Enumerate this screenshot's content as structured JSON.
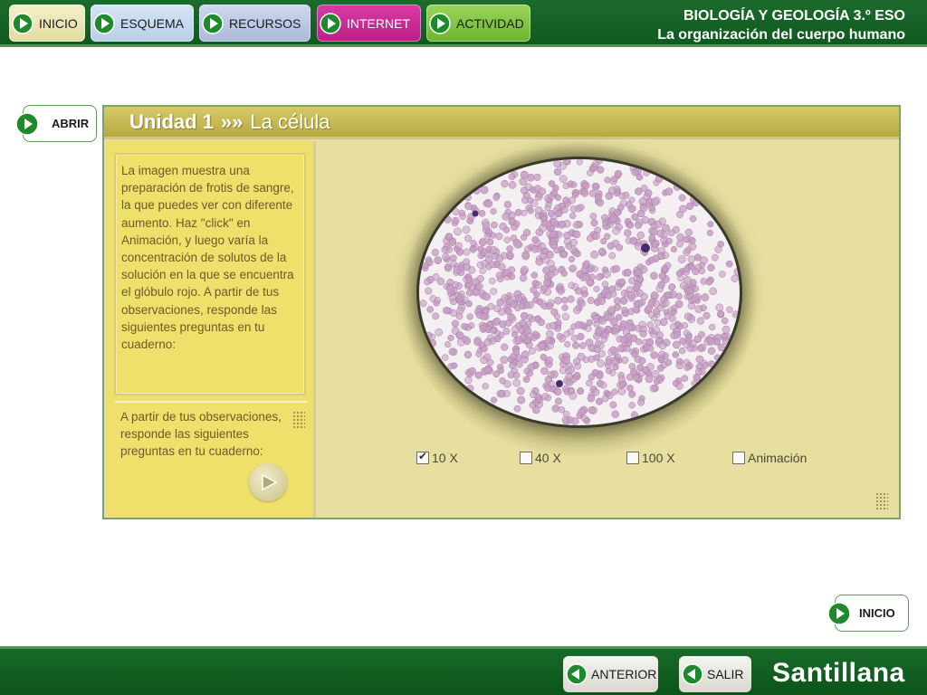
{
  "header": {
    "nav": [
      {
        "label": "INICIO"
      },
      {
        "label": "ESQUEMA"
      },
      {
        "label": "RECURSOS"
      },
      {
        "label": "INTERNET"
      },
      {
        "label": "ACTIVIDAD"
      }
    ],
    "course_line1": "BIOLOGÍA Y GEOLOGÍA 3.º ESO",
    "course_line2": "La organización del cuerpo humano"
  },
  "side": {
    "abrir_label": "ABRIR",
    "inicio_label": "INICIO"
  },
  "content": {
    "unit_label": "Unidad 1",
    "separator": "»»",
    "unit_name": "La célula",
    "instructions": "La imagen muestra una preparación de frotis de sangre, la que puedes ver con diferente aumento. Haz \"click\" en Animación, y luego varía la concentración de solutos de la solución en la que se encuentra el glóbulo rojo. A partir de tus observaciones, responde las siguientes preguntas en tu cuaderno:",
    "summary": "A partir de tus observaciones, responde las siguientes preguntas en tu cuaderno:",
    "options": [
      {
        "label": "10 X",
        "checked": true
      },
      {
        "label": "40 X",
        "checked": false
      },
      {
        "label": "100 X",
        "checked": false
      },
      {
        "label": "Animación",
        "checked": false
      }
    ]
  },
  "footer": {
    "anterior_label": "ANTERIOR",
    "salir_label": "SALIR",
    "brand": "Santillana"
  },
  "colors": {
    "header_green": "#0f5a20",
    "internet_magenta": "#c62a94",
    "actividad_green": "#7cc23e",
    "panel_yellow": "#eee06a",
    "frame_bg": "#e7df9f",
    "cell_pink": "#c79ec4"
  }
}
